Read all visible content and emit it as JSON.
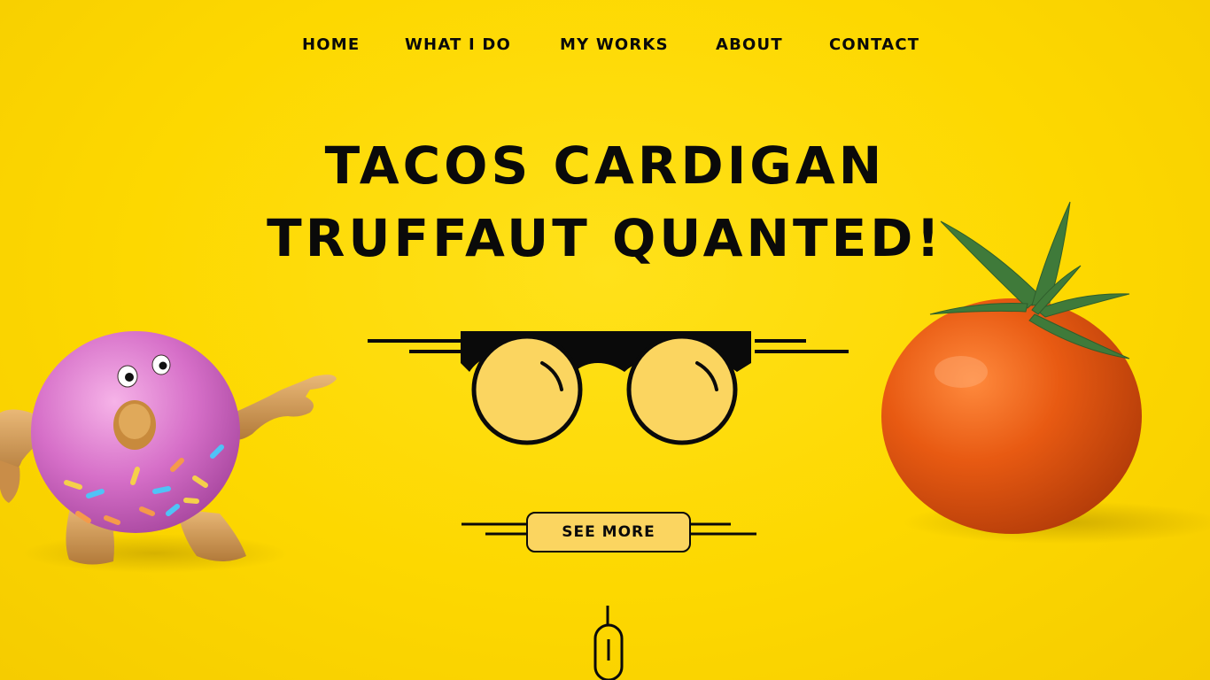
{
  "nav": {
    "items": [
      {
        "label": "HOME"
      },
      {
        "label": "WHAT I DO"
      },
      {
        "label": "MY WORKS"
      },
      {
        "label": "ABOUT"
      },
      {
        "label": "CONTACT"
      }
    ]
  },
  "hero": {
    "title_line1": "TACOS CARDIGAN",
    "title_line2": "TRUFFAUT QUANTED!",
    "cta_label": "SEE MORE"
  },
  "icons": {
    "logo": "glasses-icon",
    "scroll": "mouse-scroll-icon",
    "left_image": "donut-figure",
    "right_image": "tomato"
  },
  "colors": {
    "background": "#fdd800",
    "text": "#0a0a0a",
    "lens": "#fbd560",
    "button": "#fbd560"
  }
}
